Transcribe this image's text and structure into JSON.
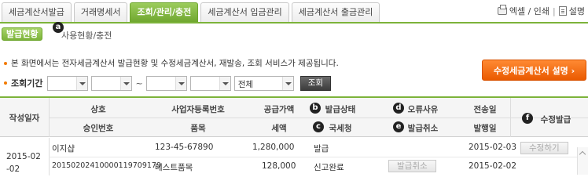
{
  "tabs": [
    {
      "label": "세금계산서발급"
    },
    {
      "label": "거래명세서"
    },
    {
      "label": "조회/관리/충전"
    },
    {
      "label": "세금계산서 입금관리"
    },
    {
      "label": "세금계산서 출금관리"
    }
  ],
  "top_right": {
    "excel_print": "엑셀 / 인쇄",
    "help": "설명"
  },
  "subtabs": {
    "active": "발급현황",
    "other": "사용현황/충전"
  },
  "badges": {
    "a": "a",
    "b": "b",
    "c": "c",
    "d": "d",
    "e": "e",
    "f": "f"
  },
  "info_text": "본 화면에서는 전자세금계산서 발급현황 및 수정세금계산서, 재발송, 조회 서비스가 제공됩니다.",
  "cta_label": "수정세금계산서 설명 ›",
  "filter": {
    "label": "조회기간",
    "tilde": "~",
    "type_value": "전체",
    "search_label": "조회"
  },
  "table": {
    "headers": {
      "date": "작성일자",
      "company": "상호",
      "approval_no": "승인번호",
      "biz_no": "사업자등록번호",
      "item": "품목",
      "supply": "공급가액",
      "tax": "세액",
      "status": "발급상태",
      "nts": "국세청",
      "error": "오류사유",
      "cancel": "발급취소",
      "sent_date": "전송일",
      "issue_date": "발행일",
      "modify": "수정발급"
    },
    "rows": [
      {
        "date": "2015-02-02",
        "company": "이지샵",
        "approval_no": "20150202410000119709179",
        "biz_no": "123-45-67890",
        "item": "테스트품목",
        "supply": "1,280,000",
        "tax": "128,000",
        "status": "발급",
        "nts": "신고완료",
        "cancel_button": "발급취소",
        "sent_date": "2015-02-03",
        "issue_date": "2015-02-02",
        "modify_button": "수정하기"
      }
    ]
  },
  "colors": {
    "accent_green": "#7cb33a",
    "cta_orange": "#f27a00",
    "badge_black": "#222222"
  }
}
